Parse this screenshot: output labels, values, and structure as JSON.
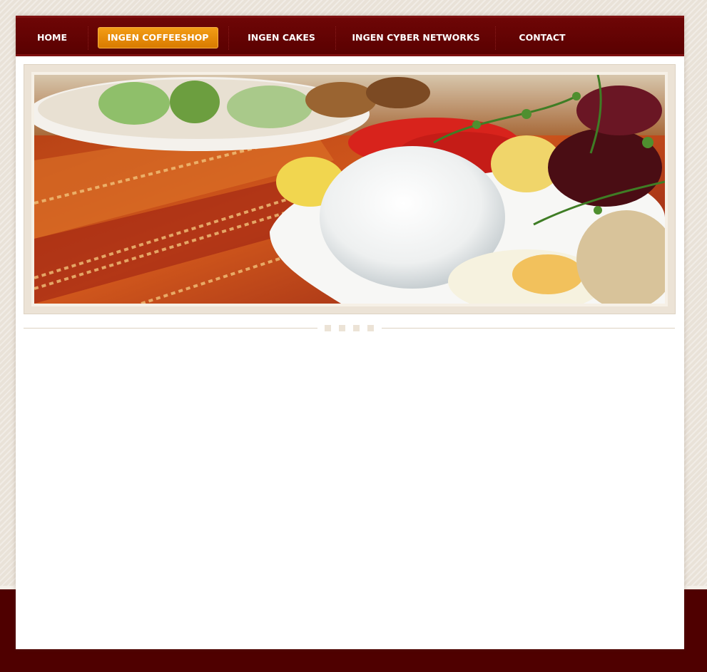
{
  "nav": {
    "items": [
      {
        "label": "HOME",
        "active": false
      },
      {
        "label": "INGEN COFFEESHOP",
        "active": true
      },
      {
        "label": "INGEN CAKES",
        "active": false
      },
      {
        "label": "INGEN CYBER NETWORKS",
        "active": false
      },
      {
        "label": "CONTACT",
        "active": false
      }
    ]
  },
  "colors": {
    "nav_background": "#5f0303",
    "active_tab": "#e48a05",
    "footer": "#4f0000",
    "page_background": "#e9e2d8",
    "content_background": "#ffffff"
  },
  "banner": {
    "icon": "food-plate-photo"
  }
}
